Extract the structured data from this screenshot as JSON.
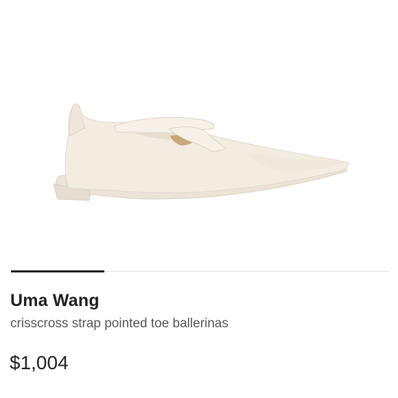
{
  "product": {
    "brand": "Uma Wang",
    "name": "crisscross strap pointed toe ballerinas",
    "price": "$1,004",
    "image_icon": "ballerina-shoe-image",
    "shoe_color": "#f3ece1",
    "image_progress_fraction": 0.25
  }
}
